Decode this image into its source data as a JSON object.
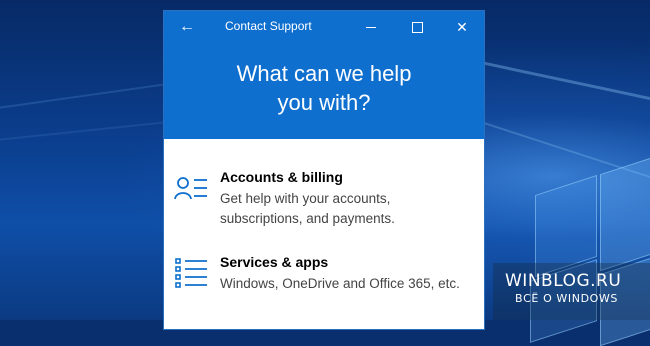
{
  "window": {
    "title": "Contact Support",
    "back_icon": "arrow-left-icon",
    "controls": [
      "minimize-icon",
      "maximize-icon",
      "close-icon"
    ],
    "accent_color": "#0f6fcf"
  },
  "hero": {
    "line1": "What can we help",
    "line2": "you with?"
  },
  "categories": [
    {
      "icon": "person-list-icon",
      "title": "Accounts & billing",
      "description": "Get help with your accounts, subscriptions, and payments."
    },
    {
      "icon": "bullet-list-icon",
      "title": "Services & apps",
      "description": "Windows, OneDrive and Office 365, etc."
    }
  ],
  "watermark": {
    "line1": "WINBLOG.RU",
    "line2": "ВСЁ О WINDOWS"
  }
}
